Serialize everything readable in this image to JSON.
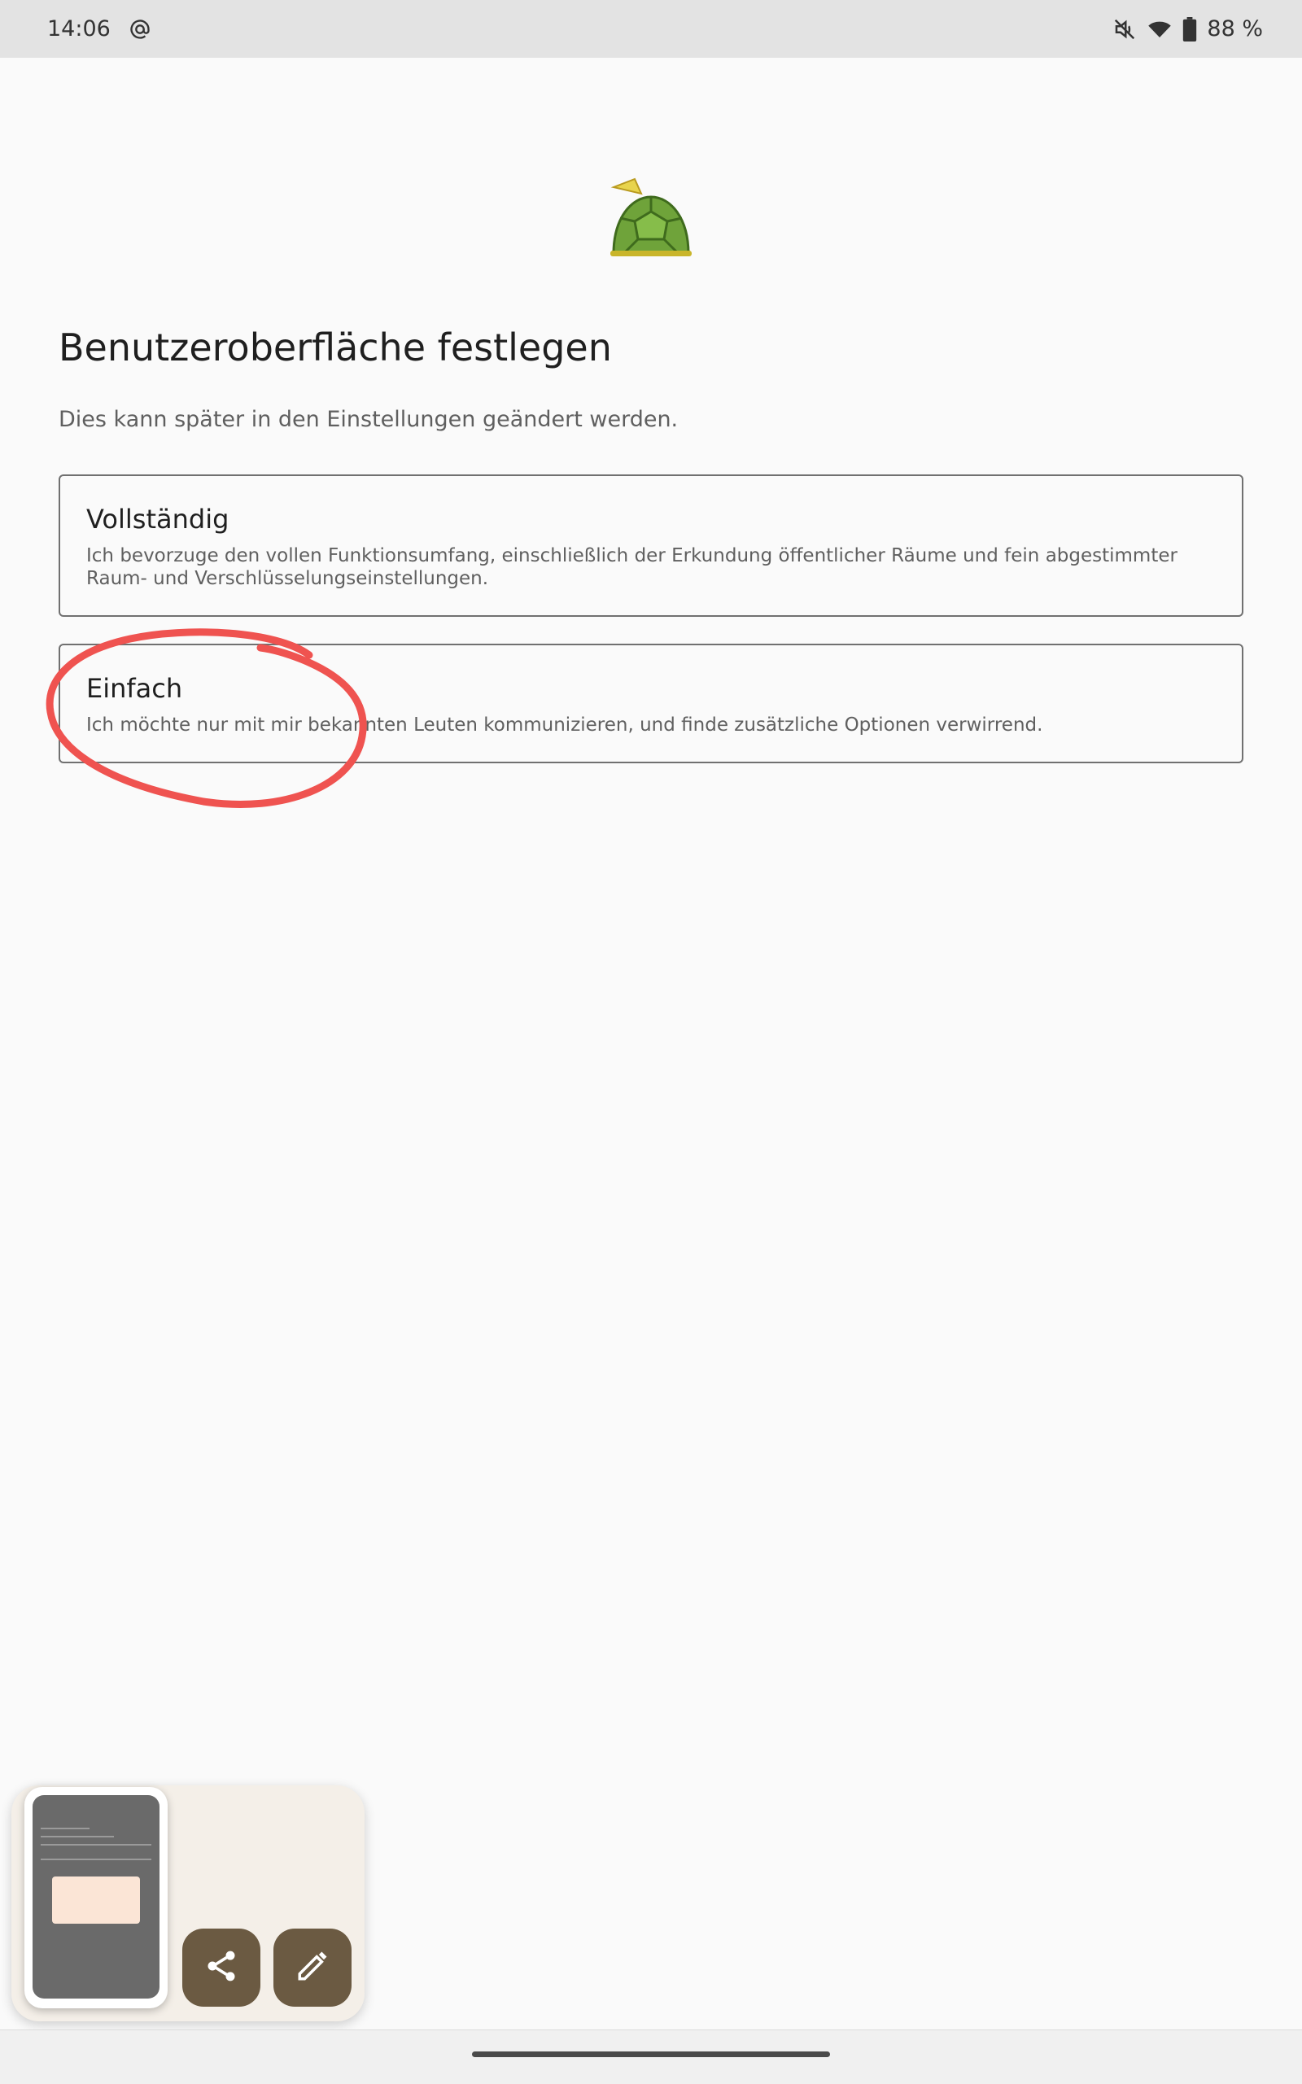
{
  "status_bar": {
    "time": "14:06",
    "at_icon": "at-sign-icon",
    "battery_text": "88 %",
    "icons": [
      "mute-icon",
      "wifi-icon",
      "battery-icon"
    ]
  },
  "page": {
    "title": "Benutzeroberfläche festlegen",
    "subtitle": "Dies kann später in den Einstellungen geändert werden."
  },
  "options": [
    {
      "title": "Vollständig",
      "description": "Ich bevorzuge den vollen Funktionsumfang, einschließlich der Erkundung öffentlicher Räume und fein abgestimmter Raum- und Verschlüsselungseinstellungen."
    },
    {
      "title": "Einfach",
      "description": "Ich möchte nur mit mir bekannten Leuten kommunizieren, und finde zusätzliche Optionen verwirrend."
    }
  ],
  "annotation_color": "#ef5350",
  "screenshot_actions": {
    "share_icon": "share-icon",
    "edit_icon": "pencil-icon",
    "accent": "#6b5a42"
  }
}
